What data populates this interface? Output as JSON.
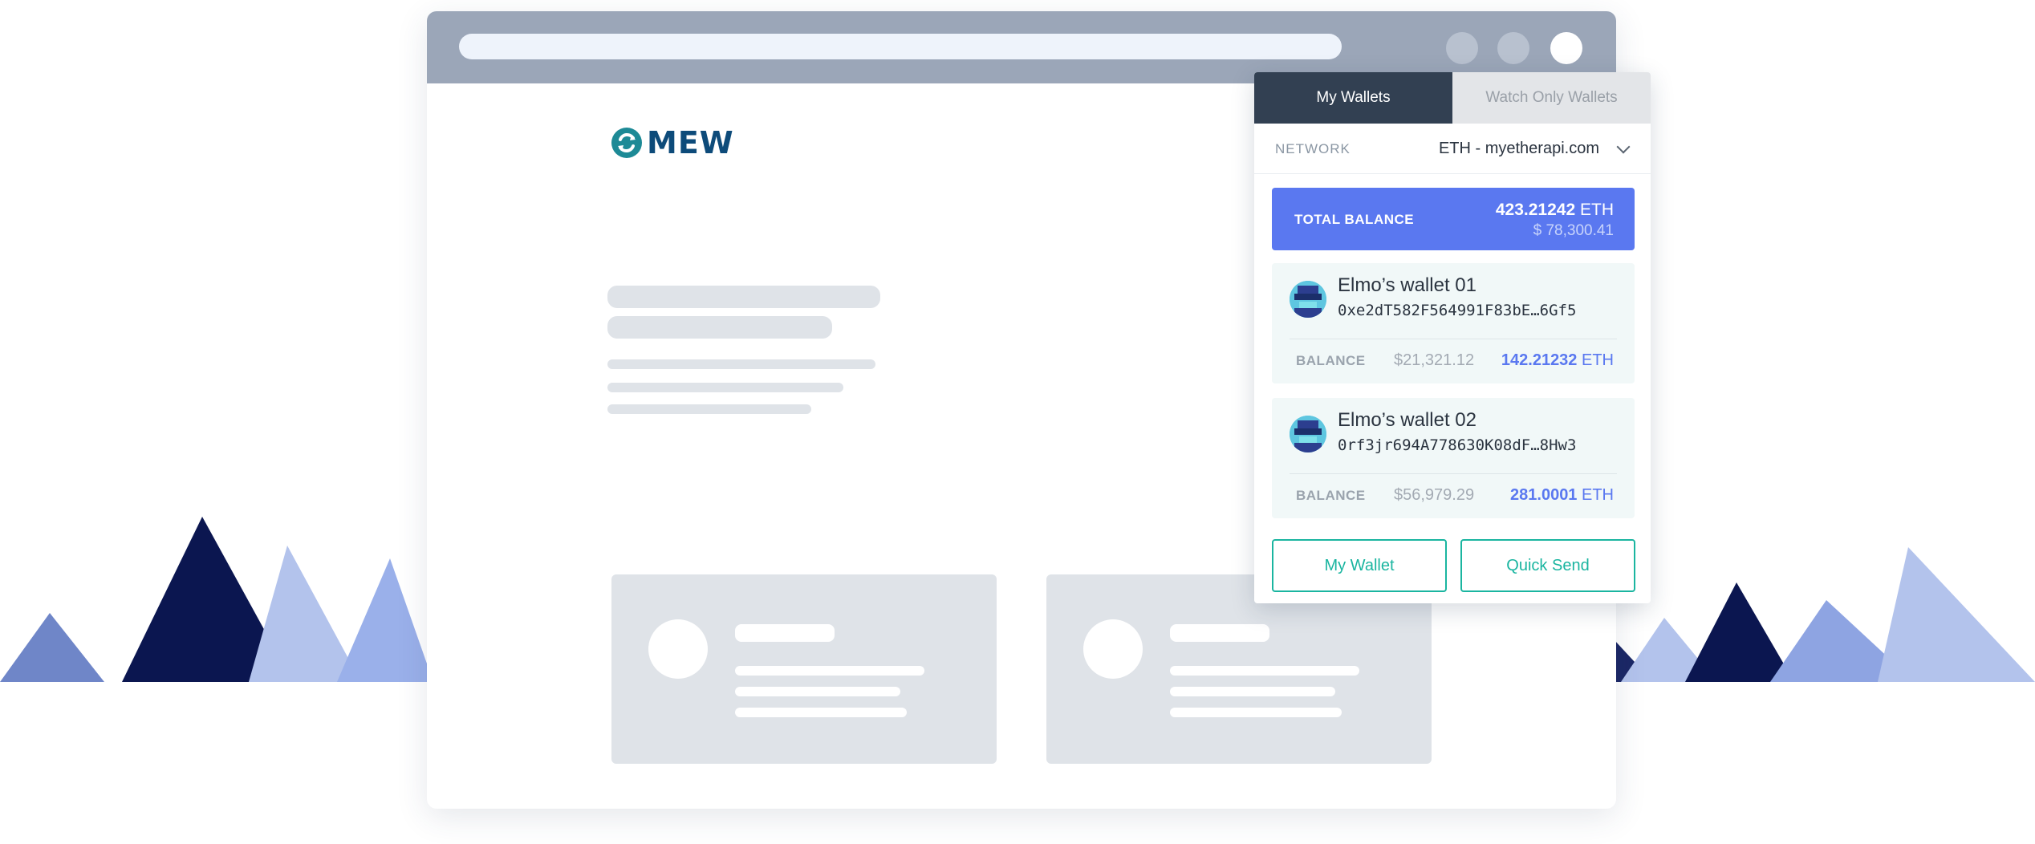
{
  "logo": {
    "text": "MEW"
  },
  "wallet_panel": {
    "tabs": [
      {
        "label": "My Wallets",
        "active": true
      },
      {
        "label": "Watch Only Wallets",
        "active": false
      }
    ],
    "network": {
      "label": "NETWORK",
      "value": "ETH - myetherapi.com"
    },
    "total_balance": {
      "label": "TOTAL BALANCE",
      "eth_amount": "423.21242",
      "eth_unit": "ETH",
      "usd": "$ 78,300.41"
    },
    "wallets": [
      {
        "name": "Elmo’s wallet 01",
        "address": "0xe2dT582F564991F83bE…6Gf5",
        "balance_label": "BALANCE",
        "usd": "$21,321.12",
        "eth_amount": "142.21232",
        "eth_unit": "ETH"
      },
      {
        "name": "Elmo’s wallet 02",
        "address": "0rf3jr694A778630K08dF…8Hw3",
        "balance_label": "BALANCE",
        "usd": "$56,979.29",
        "eth_amount": "281.0001",
        "eth_unit": "ETH"
      }
    ],
    "buttons": {
      "my_wallet": "My Wallet",
      "quick_send": "Quick Send"
    }
  },
  "icons": [
    "mew-logo-icon",
    "astronaut-illustration",
    "wallet-avatar-icon",
    "chevron-down-icon"
  ],
  "colors": {
    "accent_blue": "#5a78f0",
    "accent_teal": "#1ab5a0",
    "dark_tab": "#324052",
    "browser_bar": "#9ba6b8",
    "placeholder_gray": "#dfe3e8"
  }
}
